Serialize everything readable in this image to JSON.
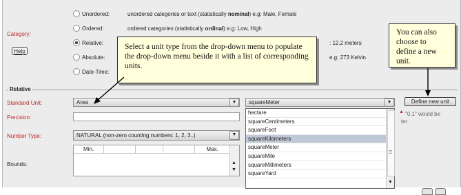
{
  "category": {
    "label": "Category:",
    "help_label": "Help",
    "options": [
      {
        "label": "Unordered:",
        "desc_pre": "unordered categories or text (statistically ",
        "desc_bold": "nominal",
        "desc_post": ") e.g: Male, Female",
        "selected": false
      },
      {
        "label": "Ordered:",
        "desc_pre": "ordered categories (statistically ",
        "desc_bold": "ordinal",
        "desc_post": ") e.g: Low, High",
        "selected": false
      },
      {
        "label": "Relative:",
        "desc_tail": ": 12.2 meters",
        "selected": true
      },
      {
        "label": "Absolute:",
        "desc_tail": "e.g: 273 Kelvin",
        "selected": false
      },
      {
        "label": "Date-Time:",
        "selected": false
      }
    ]
  },
  "relative": {
    "section_title": "Relative",
    "standard_unit_label": "Standard Unit:",
    "standard_unit_value": "Area",
    "unit_value": "squareMeter",
    "define_button": "Define new unit",
    "precision_label": "Precision:",
    "precision_hint_1": "\"0.1\" would be",
    "precision_hint_2": "ter",
    "number_type_label": "Number Type:",
    "number_type_value": "NATURAL (non-zero counting numbers: 1, 2, 3..)",
    "bounds_label": "Bounds:",
    "bounds_min": "Min.",
    "bounds_max": "Max."
  },
  "unit_options": [
    "hectare",
    "squareCentimeters",
    "squareFoot",
    "squareKilometers",
    "squareMeter",
    "squareMile",
    "squareMillimeters",
    "squareYard"
  ],
  "unit_options_highlighted_index": 3,
  "callouts": {
    "left": "Select a unit type from the drop-down menu to populate the drop-down menu beside it with a list of corresponding units.",
    "right": "You can also choose to define a new unit."
  }
}
